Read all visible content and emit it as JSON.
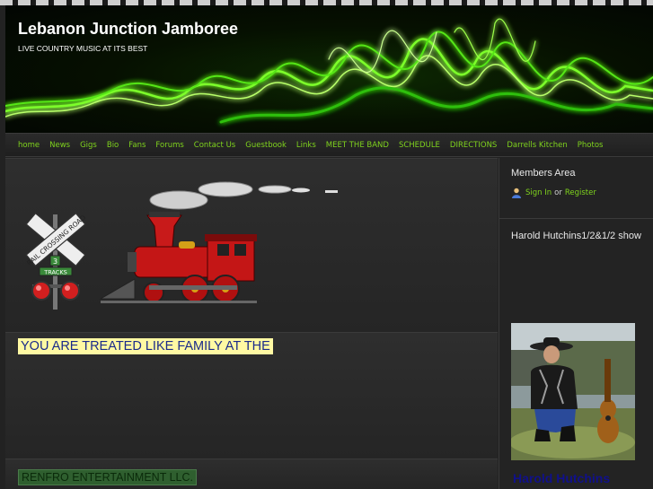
{
  "site": {
    "title": "Lebanon Junction Jamboree",
    "tagline": "LIVE COUNTRY MUSIC AT ITS BEST"
  },
  "nav": [
    "home",
    "News",
    "Gigs",
    "Bio",
    "Fans",
    "Forums",
    "Contact Us",
    "Guestbook",
    "Links",
    "MEET THE BAND",
    "SCHEDULE",
    "DIRECTIONS",
    "Darrells Kitchen",
    "Photos"
  ],
  "main": {
    "highlight": "YOU ARE TREATED LIKE FAMILY AT THE",
    "renfro": "RENFRO ENTERTAINMENT LLC."
  },
  "crossing_sign": {
    "text": "RAIL CROSSING ROAD",
    "tracks_number": "3",
    "tracks_label": "TRACKS"
  },
  "sidebar": {
    "members_title": "Members Area",
    "sign_in": "Sign In",
    "or": "or",
    "register": "Register",
    "show_title": "Harold Hutchins1/2&1/2 show",
    "photo_caption": "Harold Hutchins"
  },
  "colors": {
    "nav_link": "#7fd31d",
    "highlight_bg": "#fff9a3",
    "highlight_text": "#1a2a8a"
  }
}
